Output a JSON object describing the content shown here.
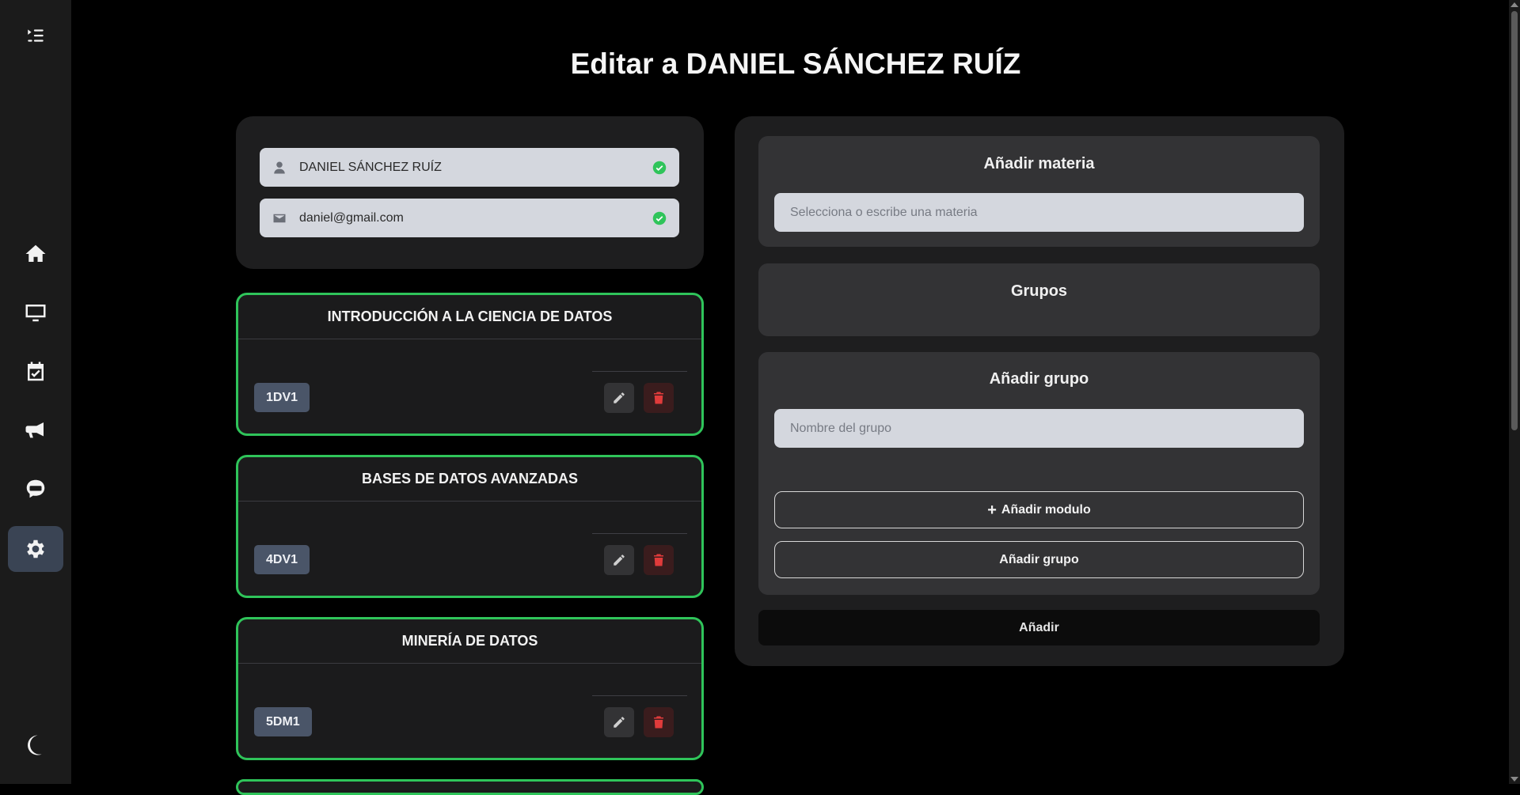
{
  "page": {
    "title": "Editar a DANIEL SÁNCHEZ RUÍZ"
  },
  "sidebar": {
    "items": [
      {
        "icon": "collapse-menu-icon"
      },
      {
        "icon": "home-icon"
      },
      {
        "icon": "monitor-icon"
      },
      {
        "icon": "calendar-check-icon"
      },
      {
        "icon": "megaphone-icon"
      },
      {
        "icon": "chat-bot-icon"
      },
      {
        "icon": "gear-icon",
        "active": true
      },
      {
        "icon": "moon-icon"
      }
    ]
  },
  "profile": {
    "name": "DANIEL SÁNCHEZ RUÍZ",
    "email": "daniel@gmail.com"
  },
  "subjects": [
    {
      "name": "INTRODUCCIÓN A LA CIENCIA DE DATOS",
      "group": "1DV1"
    },
    {
      "name": "BASES DE DATOS AVANZADAS",
      "group": "4DV1"
    },
    {
      "name": "MINERÍA DE DATOS",
      "group": "5DM1"
    }
  ],
  "right_panel": {
    "add_subject_title": "Añadir materia",
    "subject_placeholder": "Selecciona o escribe una materia",
    "groups_title": "Grupos",
    "add_group_title": "Añadir grupo",
    "group_name_placeholder": "Nombre del grupo",
    "add_module_label": "Añadir modulo",
    "add_group_button": "Añadir grupo",
    "submit_label": "Añadir"
  },
  "colors": {
    "accent_green": "#2fc45a",
    "danger_red": "#e03b3b",
    "chip_bg": "#4a5568"
  }
}
